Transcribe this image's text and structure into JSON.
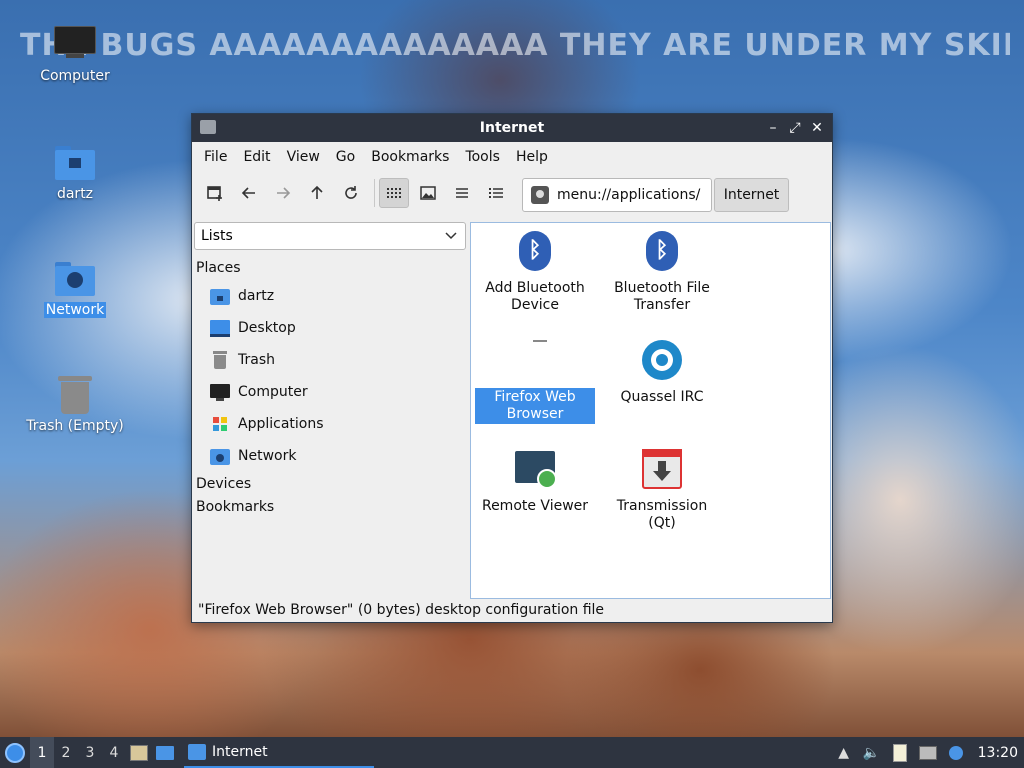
{
  "banner": "THE BUGS AAAAAAAAAAAAAA THEY ARE UNDER MY SKIN",
  "desktop": {
    "icons": [
      {
        "label": "Computer"
      },
      {
        "label": "dartz"
      },
      {
        "label": "Network"
      },
      {
        "label": "Trash (Empty)"
      }
    ]
  },
  "window": {
    "title": "Internet",
    "controls": {
      "minimize": "–",
      "maximize": "⤢",
      "close": "✕"
    },
    "menu": [
      "File",
      "Edit",
      "View",
      "Go",
      "Bookmarks",
      "Tools",
      "Help"
    ],
    "toolbar": {
      "path": "menu://applications/",
      "crumb": "Internet"
    },
    "sidepane": {
      "mode": "Lists",
      "places_heading": "Places",
      "places": [
        {
          "label": "dartz",
          "icon": "home-folder-icon"
        },
        {
          "label": "Desktop",
          "icon": "desktop-icon"
        },
        {
          "label": "Trash",
          "icon": "trash-icon"
        },
        {
          "label": "Computer",
          "icon": "computer-icon"
        },
        {
          "label": "Applications",
          "icon": "applications-icon"
        },
        {
          "label": "Network",
          "icon": "network-folder-icon"
        }
      ],
      "devices_heading": "Devices",
      "bookmarks_heading": "Bookmarks"
    },
    "files": [
      {
        "label": "Add Bluetooth Device",
        "icon": "bluetooth-icon"
      },
      {
        "label": "Bluetooth File Transfer",
        "icon": "bluetooth-icon"
      },
      {
        "label": "Firefox Web Browser",
        "icon": "firefox-icon",
        "selected": true
      },
      {
        "label": "Quassel IRC",
        "icon": "quassel-icon"
      },
      {
        "label": "Remote Viewer",
        "icon": "remote-viewer-icon"
      },
      {
        "label": "Transmission (Qt)",
        "icon": "transmission-icon"
      }
    ],
    "status": "\"Firefox Web Browser\" (0 bytes) desktop configuration file"
  },
  "taskbar": {
    "workspaces": [
      "1",
      "2",
      "3",
      "4"
    ],
    "task": "Internet",
    "clock": "13:20"
  },
  "colors": {
    "accent": "#3d8ee8",
    "titlebar": "#2e3440"
  }
}
